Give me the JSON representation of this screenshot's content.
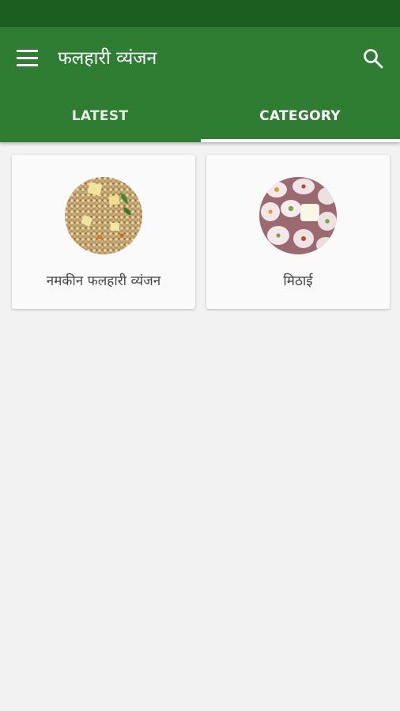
{
  "app": {
    "title": "फलहारी व्यंजन",
    "primary_color": "#2e7d32",
    "status_bar_color": "#1b5e20"
  },
  "toolbar": {
    "menu_icon": "hamburger-menu-icon",
    "search_icon": "search-icon"
  },
  "tabs": [
    {
      "label": "LATEST",
      "selected": false
    },
    {
      "label": "CATEGORY",
      "selected": true
    }
  ],
  "categories": [
    {
      "label": "नमकीन फलहारी व्यंजन",
      "image": "sabudana-namkeen-photo"
    },
    {
      "label": "मिठाई",
      "image": "sweets-photo"
    }
  ]
}
